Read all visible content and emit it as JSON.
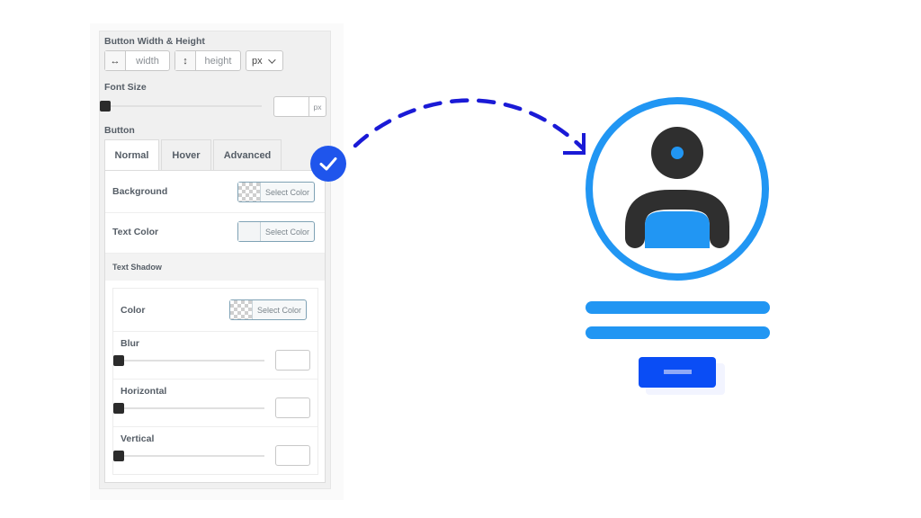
{
  "panel": {
    "dimensions": {
      "label": "Button Width & Height",
      "width_icon": "horizontal-arrows-icon",
      "width_placeholder": "width",
      "height_icon": "vertical-arrows-icon",
      "height_placeholder": "height",
      "unit": "px"
    },
    "font_size": {
      "label": "Font Size",
      "slider_value": 0,
      "unit": "px"
    },
    "button_section": {
      "label": "Button",
      "tabs": [
        {
          "label": "Normal",
          "active": true
        },
        {
          "label": "Hover",
          "active": false
        },
        {
          "label": "Advanced",
          "active": false
        }
      ],
      "background": {
        "label": "Background",
        "button": "Select Color",
        "swatch": "transparent"
      },
      "text_color": {
        "label": "Text Color",
        "button": "Select Color",
        "swatch": "none"
      },
      "text_shadow": {
        "label": "Text Shadow",
        "color": {
          "label": "Color",
          "button": "Select Color",
          "swatch": "transparent"
        },
        "blur": {
          "label": "Blur",
          "slider_value": 0
        },
        "horizontal": {
          "label": "Horizontal",
          "slider_value": 0
        },
        "vertical": {
          "label": "Vertical",
          "slider_value": 0
        }
      }
    }
  },
  "illustration": {
    "check_badge_icon": "checkmark-icon",
    "arrow": "dashed-curved-arrow",
    "avatar_icon": "user-profile-icon",
    "colors": {
      "badge": "#1f55ec",
      "arrow": "#1a1ad6",
      "ring": "#2196f3",
      "figure": "#2f2f2f",
      "accent": "#2196f3",
      "button": "#0a4df5",
      "button_dash": "#8fa9f7"
    }
  }
}
